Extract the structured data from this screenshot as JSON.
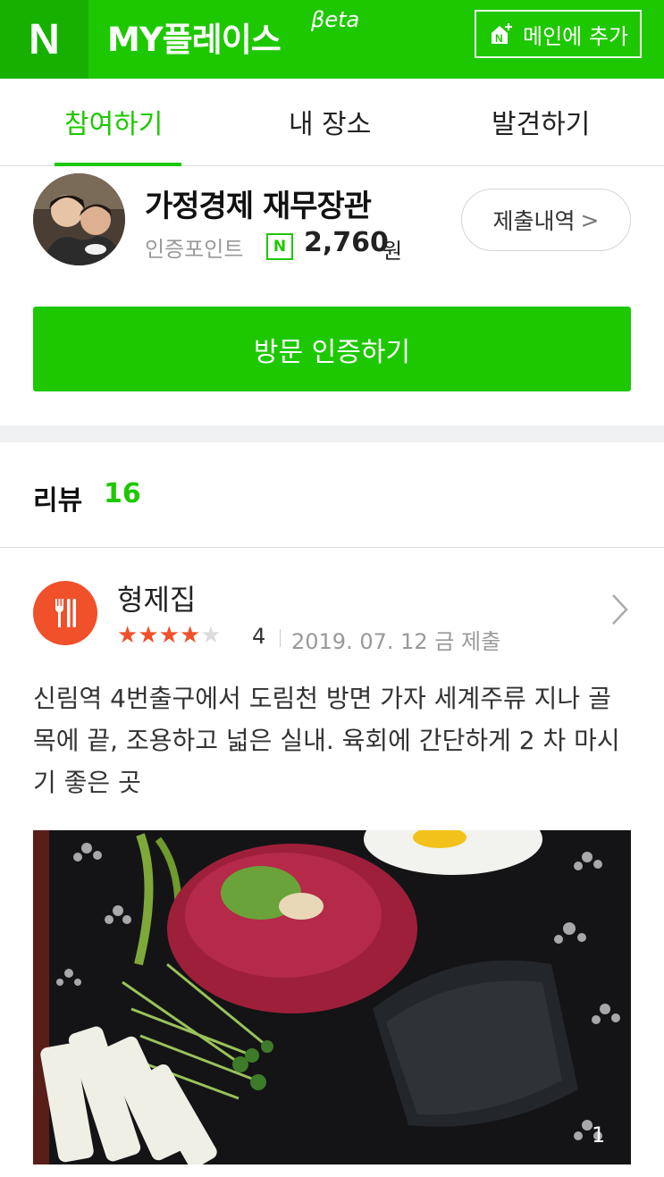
{
  "header": {
    "logo": "N",
    "title": "MY플레이스",
    "beta": "βeta",
    "add_main_label": "메인에 추가",
    "accent": "#1ec800"
  },
  "tabs": [
    {
      "label": "참여하기",
      "active": true
    },
    {
      "label": "내 장소",
      "active": false
    },
    {
      "label": "발견하기",
      "active": false
    }
  ],
  "profile": {
    "name": "가정경제 재무장관",
    "points_label": "인증포인트",
    "points_icon": "N",
    "points_value": "2,760",
    "points_unit": "원",
    "submit_history_label": "제출내역",
    "submit_history_chevron": ">"
  },
  "visit_button_label": "방문 인증하기",
  "reviews": {
    "heading": "리뷰",
    "count": "16",
    "items": [
      {
        "place": "형제집",
        "category_icon": "restaurant-icon",
        "rating": "4",
        "stars_filled": 4,
        "stars_total": 5,
        "date": "2019. 07. 12 금 제출",
        "text": "신림역 4번출구에서 도림천 방면 가자 세계주류 지나 골목에 끝, 조용하고 넓은 실내. 육회에 간단하게 2 차 마시기 좋은 곳",
        "photo_index": "1"
      }
    ]
  }
}
